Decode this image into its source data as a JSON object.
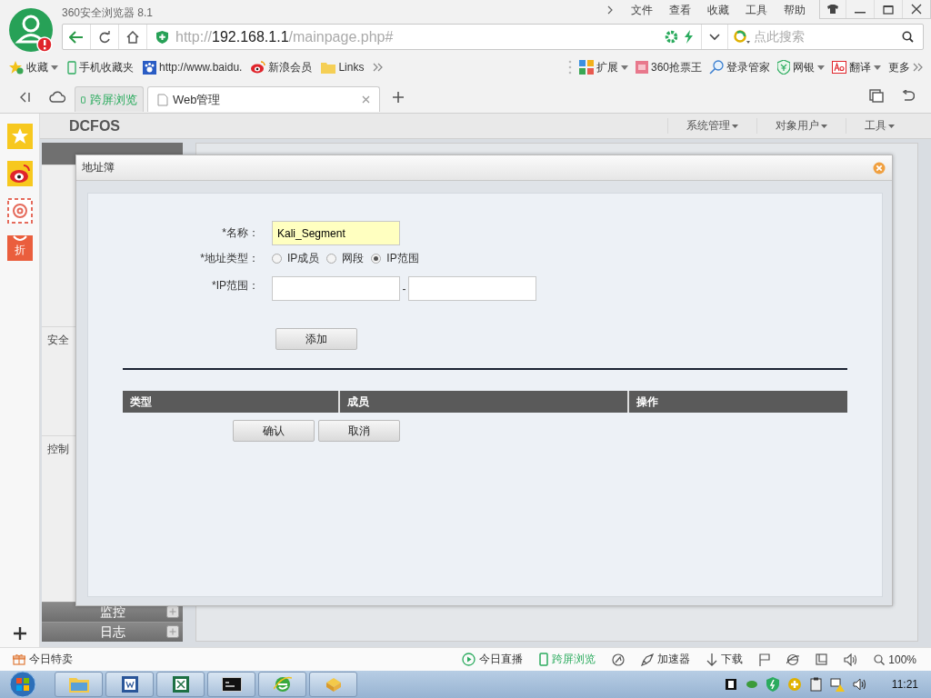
{
  "browser": {
    "title": "360安全浏览器 8.1",
    "menu": [
      "文件",
      "查看",
      "收藏",
      "工具",
      "帮助"
    ],
    "address": {
      "scheme": "http://",
      "host": "192.168.1.1",
      "path": "/mainpage.php#"
    },
    "search_placeholder": "点此搜索"
  },
  "bookmarks": [
    {
      "kind": "favorites",
      "label": "收藏"
    },
    {
      "kind": "phone",
      "label": "手机收藏夹"
    },
    {
      "kind": "paw",
      "label": "http://www.baidu."
    },
    {
      "kind": "weibo",
      "label": "新浪会员"
    },
    {
      "kind": "folder",
      "label": "Links"
    }
  ],
  "extensions": [
    {
      "kind": "grid",
      "label": "扩展",
      "menu": true
    },
    {
      "kind": "ticket",
      "label": "360抢票王",
      "menu": false
    },
    {
      "kind": "key",
      "label": "登录管家",
      "menu": false
    },
    {
      "kind": "shield",
      "label": "网银",
      "menu": true
    },
    {
      "kind": "translate",
      "label": "翻译",
      "menu": true
    },
    {
      "kind": "more",
      "label": "更多",
      "menu": false
    }
  ],
  "tabs": [
    {
      "kind": "phone",
      "label": "跨屏浏览",
      "selected": false
    },
    {
      "kind": "page",
      "label": "Web管理",
      "selected": true
    }
  ],
  "rail": {
    "deal_label": "折"
  },
  "app": {
    "logo": "DCFOS",
    "menu": [
      "系统管理",
      "对象用户",
      "工具"
    ],
    "nav_sections": [
      "安全",
      "控制"
    ],
    "nav_groups": [
      "监控",
      "日志"
    ]
  },
  "dialog": {
    "title": "地址簿",
    "name_label": "*名称：",
    "name_value": "Kali_Segment",
    "type_label": "*地址类型：",
    "type_options": [
      {
        "label": "IP成员",
        "selected": false
      },
      {
        "label": "网段",
        "selected": false
      },
      {
        "label": "IP范围",
        "selected": true
      }
    ],
    "range_label": "*IP范围：",
    "range_separator": "-",
    "add_button": "添加",
    "columns": [
      "类型",
      "成员",
      "操作"
    ],
    "buttons": [
      "确认",
      "取消"
    ]
  },
  "status_bar": {
    "deal": "今日特卖",
    "live": "今日直播",
    "cross_screen": "跨屏浏览",
    "accelerator": "加速器",
    "download": "下载",
    "zoom": "100%"
  },
  "taskbar": {
    "clock": "11:21"
  }
}
